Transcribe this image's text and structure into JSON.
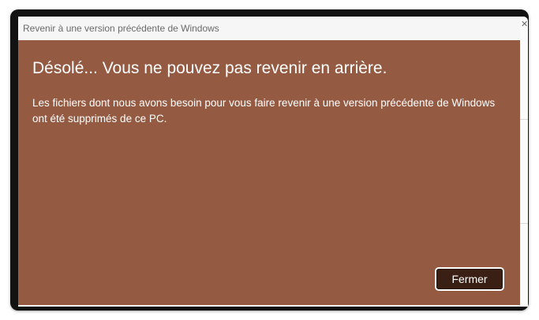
{
  "window": {
    "title": "Revenir à une version précédente de Windows"
  },
  "dialog": {
    "heading": "Désolé... Vous ne pouvez pas revenir en arrière.",
    "message": "Les fichiers dont nous avons besoin pour vous faire revenir à une version précédente de Windows ont été supprimés de ce PC.",
    "close_label": "Fermer"
  },
  "background_window": {
    "close_glyph": "✕"
  },
  "colors": {
    "dialog_background": "#955a42",
    "titlebar_background": "#f6f6f6",
    "button_background": "#3a1f14",
    "text": "#ffffff"
  }
}
